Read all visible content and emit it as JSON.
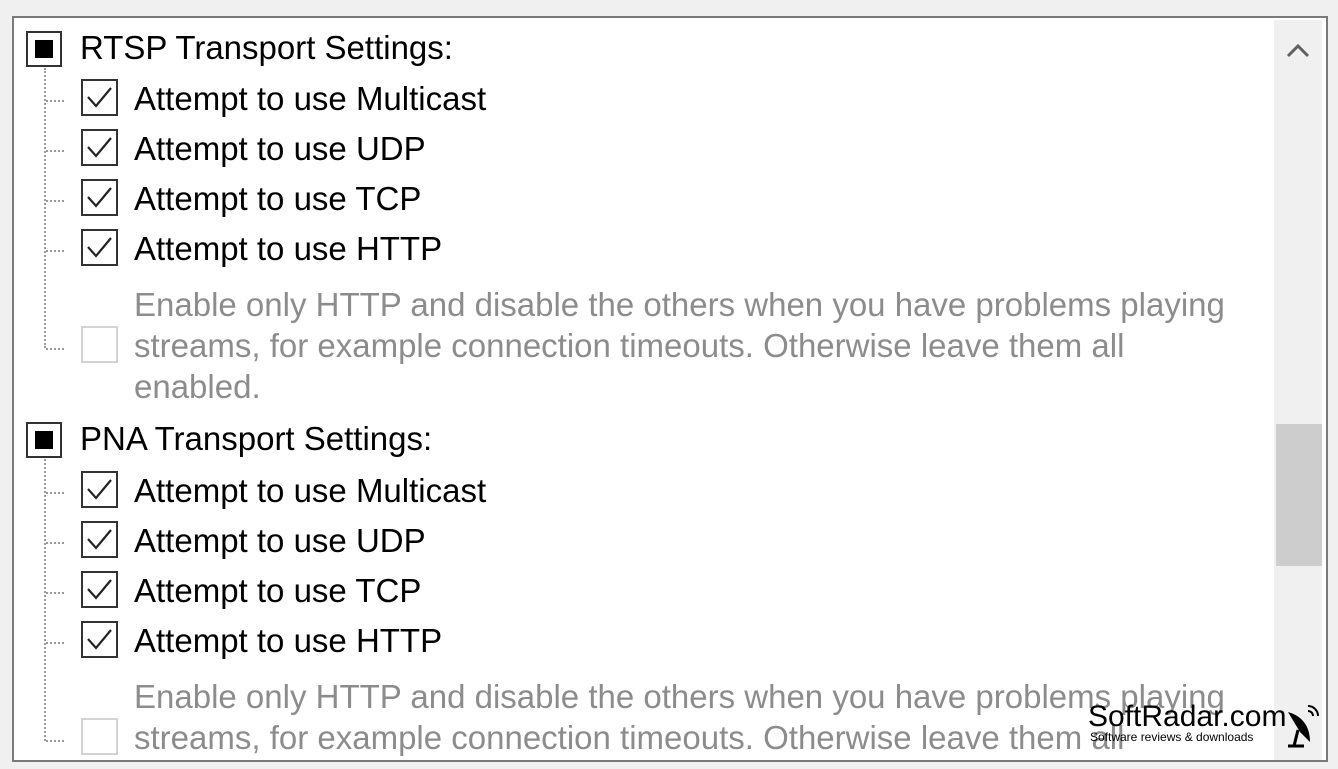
{
  "groups": [
    {
      "title": "RTSP Transport Settings:",
      "options": [
        {
          "label": "Attempt to use Multicast",
          "checked": true
        },
        {
          "label": "Attempt to use UDP",
          "checked": true
        },
        {
          "label": "Attempt to use TCP",
          "checked": true
        },
        {
          "label": "Attempt to use HTTP",
          "checked": true
        }
      ],
      "note_lines": [
        "Enable only HTTP and disable the others when you have problems playing",
        "streams, for example connection timeouts. Otherwise leave them all",
        "enabled."
      ]
    },
    {
      "title": "PNA Transport Settings:",
      "options": [
        {
          "label": "Attempt to use Multicast",
          "checked": true
        },
        {
          "label": "Attempt to use UDP",
          "checked": true
        },
        {
          "label": "Attempt to use TCP",
          "checked": true
        },
        {
          "label": "Attempt to use HTTP",
          "checked": true
        }
      ],
      "note_lines": [
        "Enable only HTTP and disable the others when you have problems playing",
        "streams, for example connection timeouts. Otherwise leave them all"
      ]
    }
  ],
  "scrollbar": {
    "up_icon": "chevron-up-icon"
  },
  "watermark": {
    "title": "SoftRadar.com",
    "subtitle": "Software reviews & downloads"
  }
}
